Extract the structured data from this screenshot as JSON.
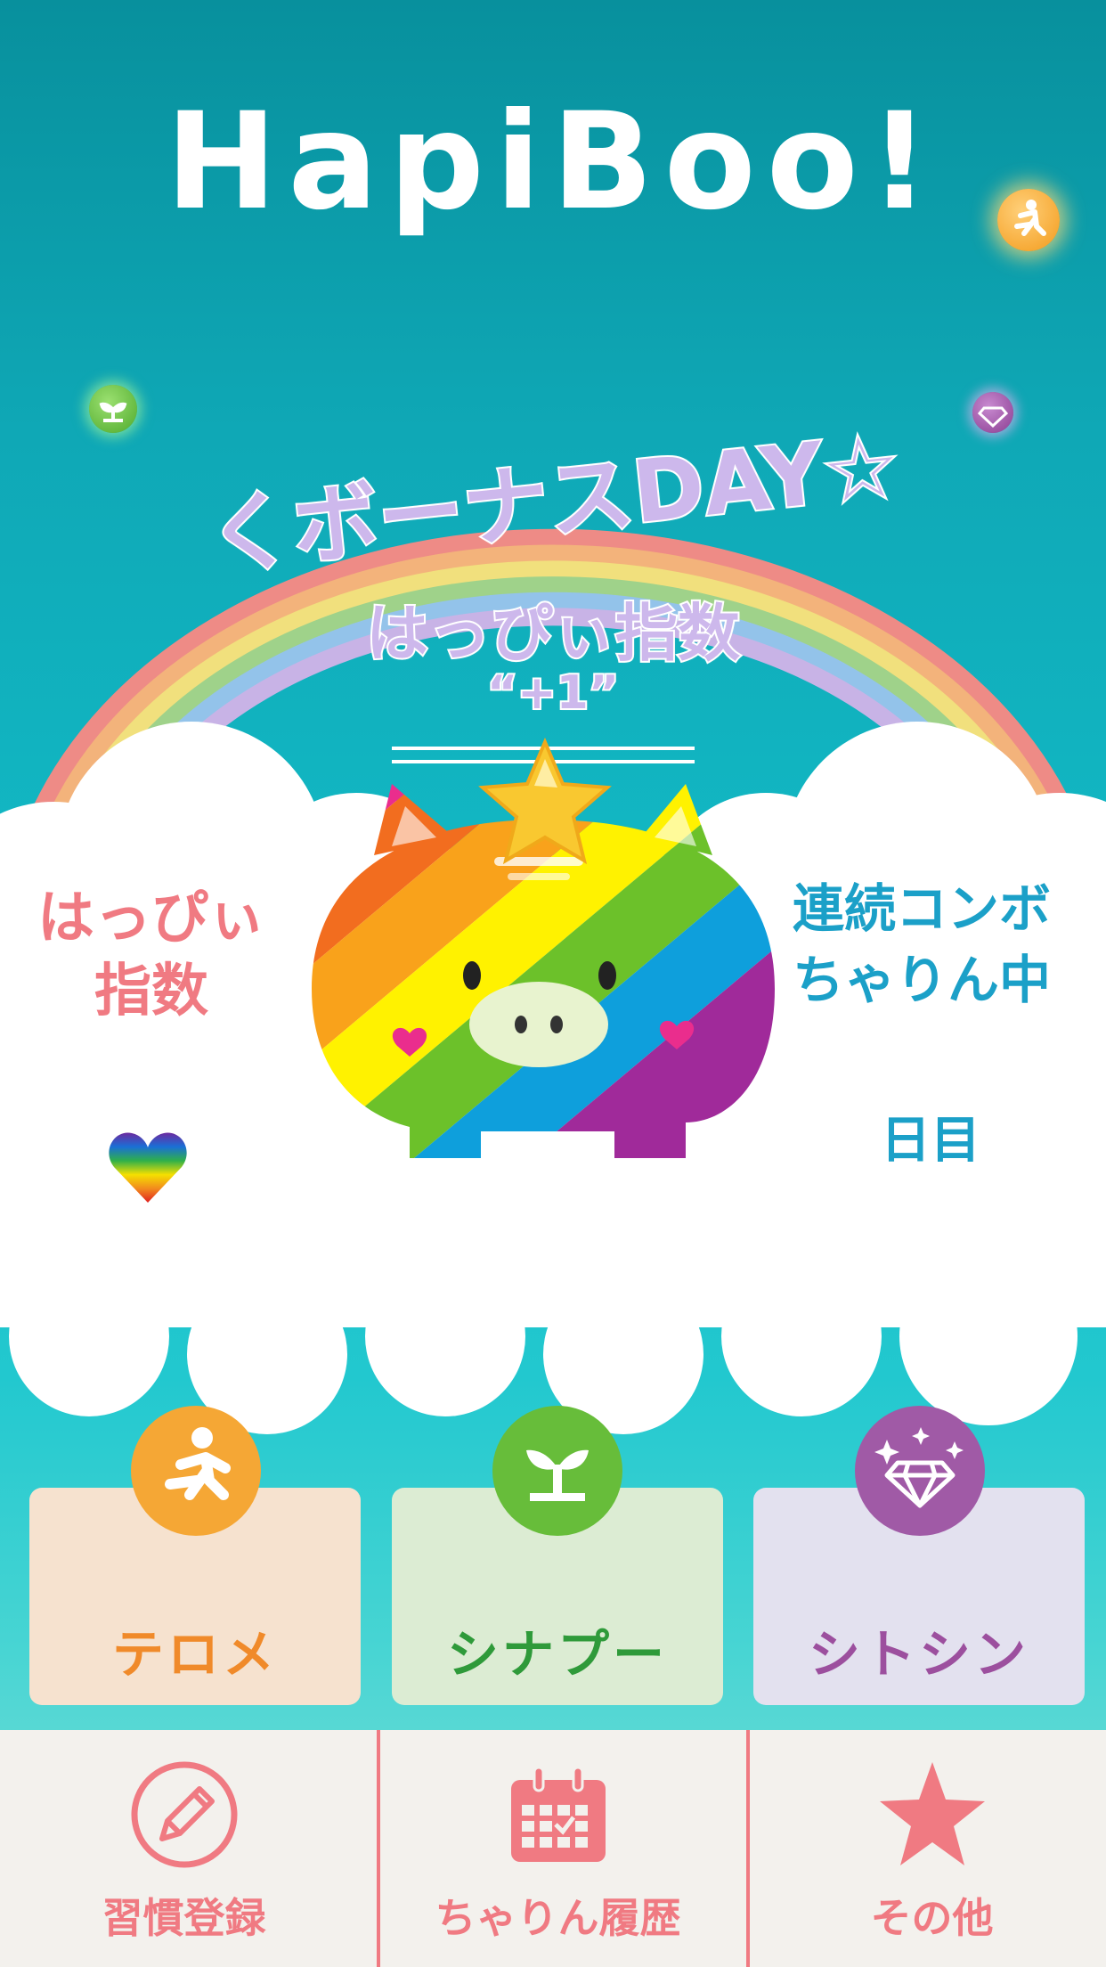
{
  "app": {
    "logo": "HapiBoo!"
  },
  "bonus": {
    "line1": "くボーナスDAY☆",
    "line2": "はっぴぃ指数",
    "line3": "“+1”"
  },
  "stats": {
    "happy_label_line1": "はっぴぃ",
    "happy_label_line2": "指数",
    "combo_label_line1": "連続コンボ",
    "combo_label_line2": "ちゃりん中",
    "days_suffix": "日目"
  },
  "categories": [
    {
      "label": "テロメ",
      "icon": "running-person-icon",
      "color": "#f5a735",
      "card_bg": "#f6e2cf",
      "text_color": "#f08a2a"
    },
    {
      "label": "シナプー",
      "icon": "sprout-icon",
      "color": "#67bd3a",
      "card_bg": "#dcecd3",
      "text_color": "#2f9a3a"
    },
    {
      "label": "シトシン",
      "icon": "diamond-icon",
      "color": "#a05aa6",
      "card_bg": "#e3e1ef",
      "text_color": "#9c4f9e"
    }
  ],
  "tabs": [
    {
      "label": "習慣登録",
      "icon": "pencil-icon"
    },
    {
      "label": "ちゃりん履歴",
      "icon": "calendar-icon"
    },
    {
      "label": "その他",
      "icon": "star-icon"
    }
  ],
  "colors": {
    "accent_pink": "#f07a82",
    "accent_blue": "#1ba0c8",
    "bonus_text": "#cdb8ec"
  }
}
